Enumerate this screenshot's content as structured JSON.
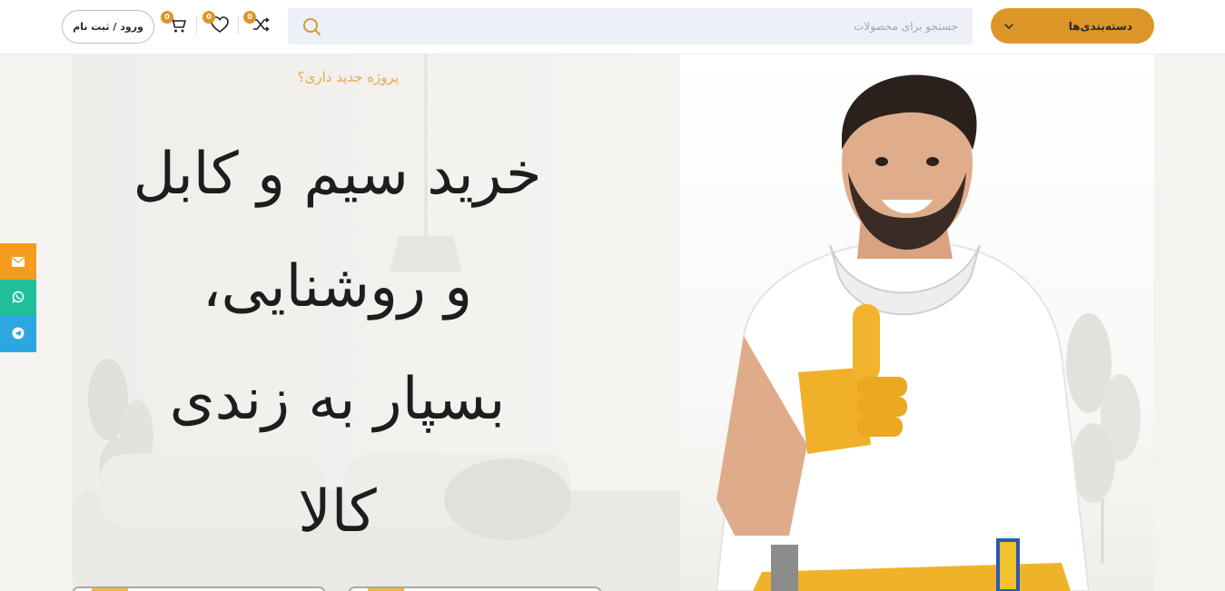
{
  "header": {
    "categories_label": "دسته‌بندی‌ها",
    "search_placeholder": "جستجو برای محصولات",
    "compare_count": "0",
    "wishlist_count": "0",
    "cart_count": "0",
    "login_label": "ورود / ثبت نام"
  },
  "hero": {
    "eyebrow": "پروژه جدید داری؟",
    "headline_lines": [
      "خرید سیم و کابل",
      "و روشنایی،",
      "بسپار به زندی",
      "کالا"
    ]
  },
  "colors": {
    "accent": "#dc9628",
    "search_bg": "#edf0f8",
    "email": "#f39c1f",
    "whatsapp": "#1fbf9a",
    "telegram": "#2da7df"
  },
  "floating": {
    "icons": [
      "envelope-icon",
      "whatsapp-icon",
      "telegram-icon"
    ]
  }
}
